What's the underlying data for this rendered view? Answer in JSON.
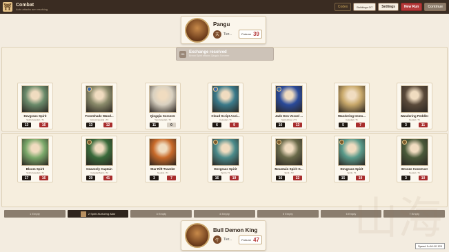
{
  "app": {
    "logo_glyph": "⛩",
    "title": "Combat",
    "subtitle": "Auto attacks are resolving"
  },
  "toolbar": {
    "codex": "Codex",
    "buildings": "Buildings 0/7",
    "settings": "Settings",
    "new_run": "New Run",
    "continue": "Continue"
  },
  "enemy_hero": {
    "name": "Pangu",
    "badge": "天",
    "tier": "Tier...",
    "fortune_label": "Fortune",
    "fortune_value": "39"
  },
  "player_hero": {
    "name": "Bull Demon King",
    "badge": "牛",
    "tier": "Tier...",
    "fortune_label": "Fortune",
    "fortune_value": "47"
  },
  "toast": {
    "icon": "Hit",
    "title": "Exchange resolved",
    "subtitle": "Brown Spirit attacks Qingqiu Sorcerer"
  },
  "enemy_row": [
    {
      "name": "Devgrass Spirit",
      "type": "Spirit•Celestial • T1",
      "atk": "13",
      "hp": "16",
      "art": "#6a8a6a"
    },
    {
      "name": "Frostshade Wand...",
      "type": "Ghost•Celestial • T2",
      "atk": "13",
      "hp": "12",
      "art": "#8a8a6a"
    },
    {
      "name": "Qingqiu Sorcerer",
      "type": "Yao•Celestial • T2",
      "atk": "11",
      "hp": "0",
      "art": "#d8d0c0"
    },
    {
      "name": "Cloud Script Acol...",
      "type": "Celestial • T1",
      "atk": "6",
      "hp": "9",
      "art": "#3a7a8a"
    },
    {
      "name": "Jade Den Vessel ...",
      "type": "Spirit•Ghost • T3",
      "atk": "10",
      "hp": "13",
      "art": "#2a4a9a"
    },
    {
      "name": "Wandering Immo...",
      "type": "Celestial • T1",
      "atk": "5",
      "hp": "7",
      "art": "#c8a86a"
    },
    {
      "name": "Wandering Peddler",
      "type": "Neutral • T1",
      "atk": "3",
      "hp": "11",
      "art": "#5a4a3a"
    }
  ],
  "player_row": [
    {
      "name": "Bloom Spirit",
      "type": "Spirit•Celestial • T2",
      "atk": "17",
      "hp": "16",
      "art": "#7aa86a"
    },
    {
      "name": "Heavenly Captain",
      "type": "Celestial•Spirit • T2",
      "atk": "29",
      "hp": "41",
      "art": "#3a6a3a"
    },
    {
      "name": "Star Rift Traveler",
      "type": "Neutral • T1",
      "atk": "3",
      "hp": "7",
      "art": "#c86a2a"
    },
    {
      "name": "Devgrass Spirit",
      "type": "Spirit • T1",
      "atk": "16",
      "hp": "19",
      "art": "#4a8a8a"
    },
    {
      "name": "Mountain Spirit G...",
      "type": "Spirit • T3",
      "atk": "16",
      "hp": "22",
      "art": "#6a6a4a"
    },
    {
      "name": "Devgrass Spirit",
      "type": "Spirit • T1",
      "atk": "15",
      "hp": "19",
      "art": "#5a9a8a"
    },
    {
      "name": "Bronze Construct",
      "type": "Neutral • T1",
      "atk": "3",
      "hp": "10",
      "art": "#4a5a3a"
    }
  ],
  "slots": [
    "1 Empty",
    "2 Spirit-Nurturing Altar",
    "3 Empty",
    "4 Empty",
    "5 Empty",
    "6 Empty",
    "7 Empty"
  ],
  "watermark": "山海",
  "speed_label": "Speed 1×16:10 120"
}
